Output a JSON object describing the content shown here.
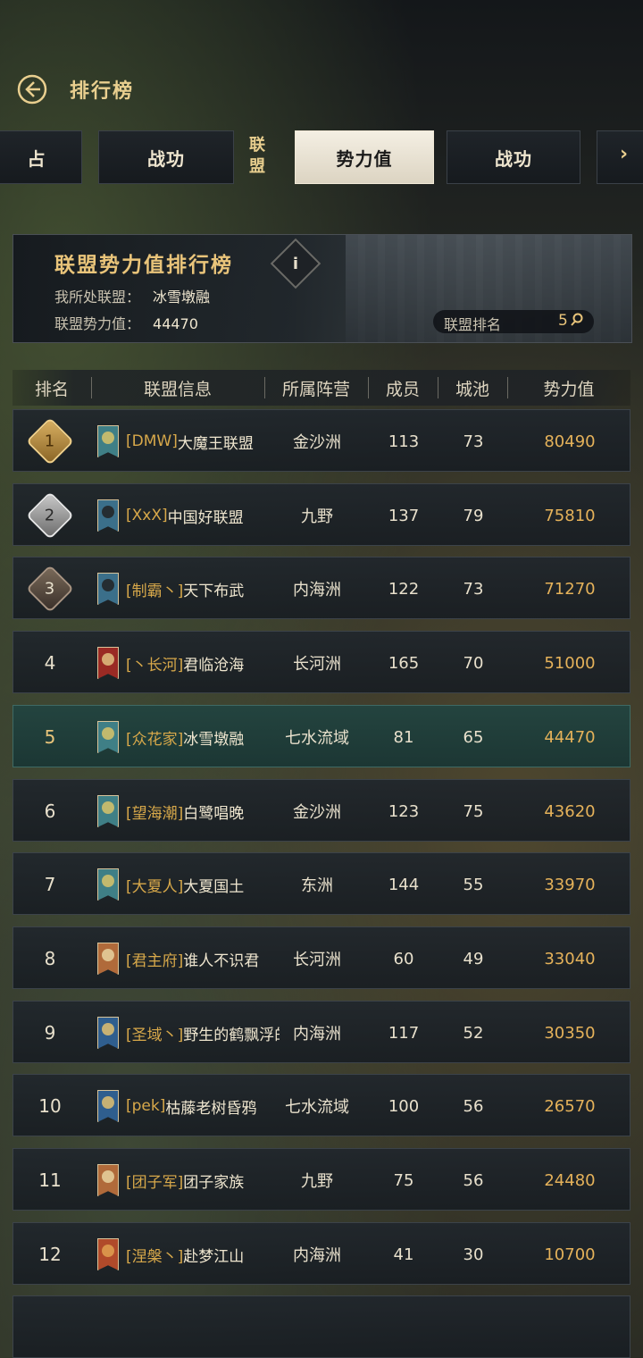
{
  "header": {
    "title": "排行榜"
  },
  "tabs": {
    "items": [
      {
        "label": "占"
      },
      {
        "label": "战功"
      },
      {
        "label": "势力值"
      },
      {
        "label": "战功"
      }
    ],
    "group_label_line1": "联",
    "group_label_line2": "盟",
    "next_arrow": "›"
  },
  "banner": {
    "title": "联盟势力值排行榜",
    "info": "i",
    "my_alliance_label": "我所处联盟：",
    "my_alliance_value": "冰雪墩融",
    "power_label": "联盟势力值：",
    "power_value": "44470",
    "rank_label": "联盟排名",
    "rank_value": "5"
  },
  "table": {
    "headers": [
      "排名",
      "联盟信息",
      "所属阵营",
      "成员",
      "城池",
      "势力值"
    ],
    "rows": [
      {
        "rank": "1",
        "tag": "[DMW]",
        "name": "大魔王联盟",
        "camp": "金沙洲",
        "members": "113",
        "cities": "73",
        "power": "80490",
        "flag": "#3f7f86",
        "emblem": "#d8c36a"
      },
      {
        "rank": "2",
        "tag": "[XxX]",
        "name": "中国好联盟",
        "camp": "九野",
        "members": "137",
        "cities": "79",
        "power": "75810",
        "flag": "#3b6f8a",
        "emblem": "#222222"
      },
      {
        "rank": "3",
        "tag": "[制霸丶]",
        "name": "天下布武",
        "camp": "内海洲",
        "members": "122",
        "cities": "73",
        "power": "71270",
        "flag": "#3b6f8a",
        "emblem": "#222222"
      },
      {
        "rank": "4",
        "tag": "[丶长河]",
        "name": "君临沧海",
        "camp": "长河洲",
        "members": "165",
        "cities": "70",
        "power": "51000",
        "flag": "#9a2a24",
        "emblem": "#e0c080"
      },
      {
        "rank": "5",
        "tag": "[众花家]",
        "name": "冰雪墩融",
        "camp": "七水流域",
        "members": "81",
        "cities": "65",
        "power": "44470",
        "flag": "#3f7f86",
        "emblem": "#d8c36a"
      },
      {
        "rank": "6",
        "tag": "[望海潮]",
        "name": "白鹭唱晚",
        "camp": "金沙洲",
        "members": "123",
        "cities": "75",
        "power": "43620",
        "flag": "#3f7f86",
        "emblem": "#d8c36a"
      },
      {
        "rank": "7",
        "tag": "[大夏人]",
        "name": "大夏国土",
        "camp": "东洲",
        "members": "144",
        "cities": "55",
        "power": "33970",
        "flag": "#3f7f86",
        "emblem": "#d8c36a"
      },
      {
        "rank": "8",
        "tag": "[君主府]",
        "name": "谁人不识君",
        "camp": "长河洲",
        "members": "60",
        "cities": "49",
        "power": "33040",
        "flag": "#b06a3a",
        "emblem": "#e8d2a0"
      },
      {
        "rank": "9",
        "tag": "[圣域丶]",
        "name": "野生的鹤飘浮的云",
        "camp": "内海洲",
        "members": "117",
        "cities": "52",
        "power": "30350",
        "flag": "#2f5e8e",
        "emblem": "#e0c070"
      },
      {
        "rank": "10",
        "tag": "[pek]",
        "name": "枯藤老树昏鸦",
        "camp": "七水流域",
        "members": "100",
        "cities": "56",
        "power": "26570",
        "flag": "#2f5e8e",
        "emblem": "#e0c070"
      },
      {
        "rank": "11",
        "tag": "[团子军]",
        "name": "团子家族",
        "camp": "九野",
        "members": "75",
        "cities": "56",
        "power": "24480",
        "flag": "#b06a3a",
        "emblem": "#e8d2a0"
      },
      {
        "rank": "12",
        "tag": "[涅槃丶]",
        "name": "赴梦江山",
        "camp": "内海洲",
        "members": "41",
        "cities": "30",
        "power": "10700",
        "flag": "#b04a2a",
        "emblem": "#e0a050"
      }
    ]
  }
}
